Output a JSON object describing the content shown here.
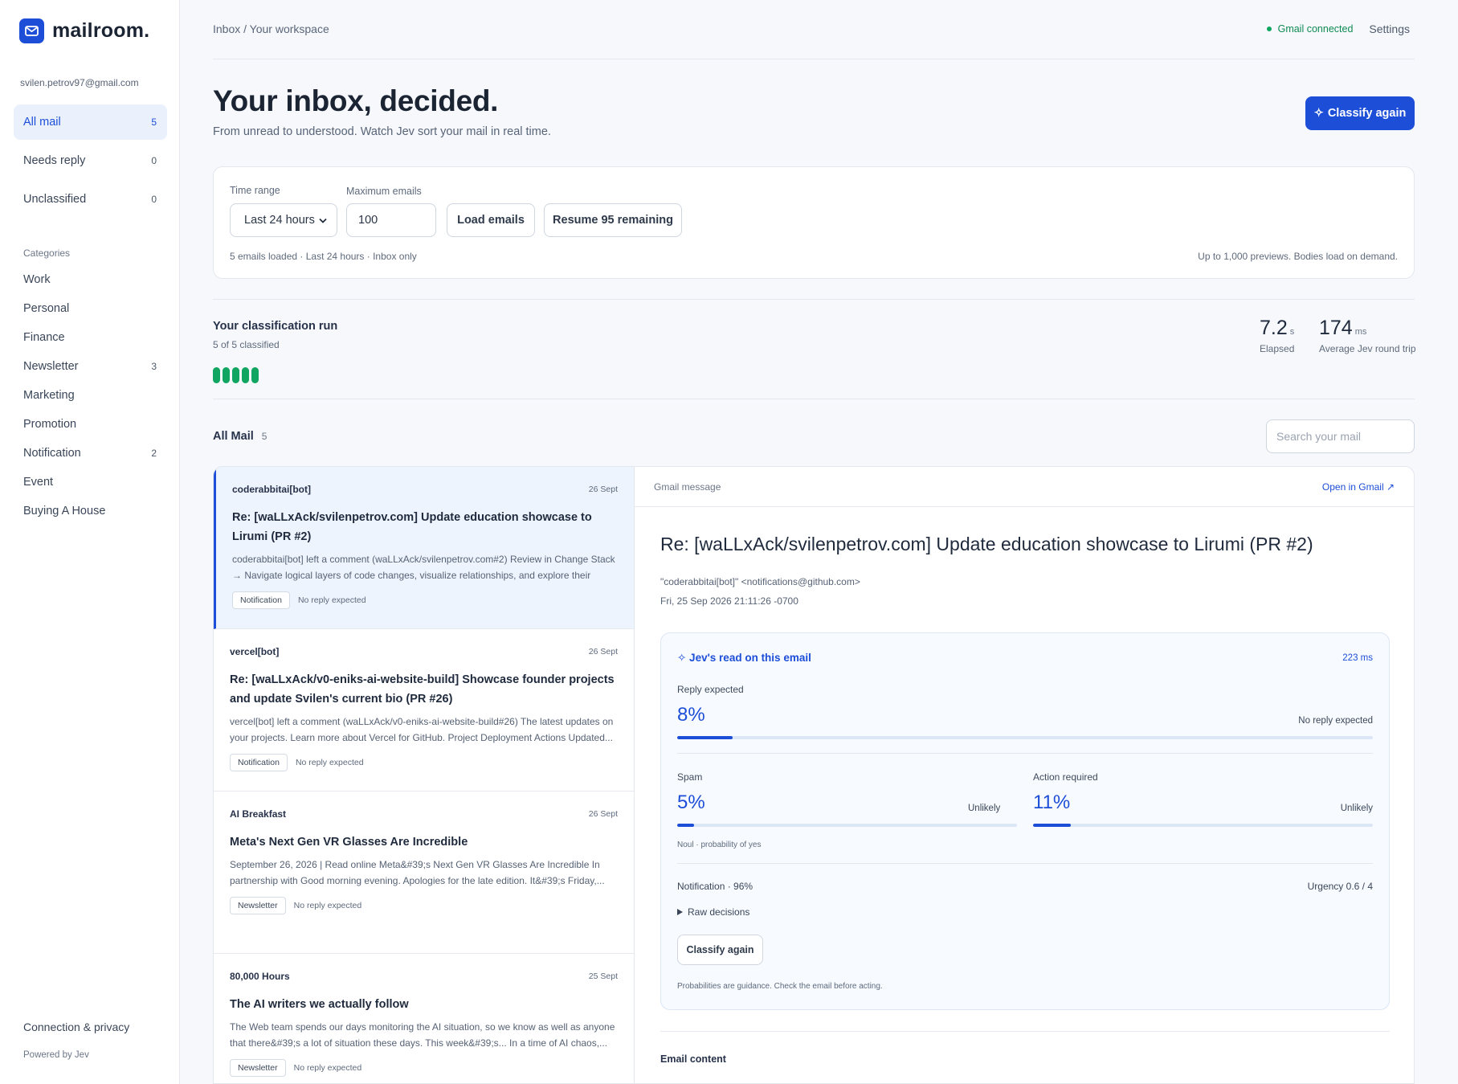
{
  "brand": {
    "name": "mailroom."
  },
  "account": {
    "email": "svilen.petrov97@gmail.com"
  },
  "nav": [
    {
      "label": "All mail",
      "count": "5"
    },
    {
      "label": "Needs reply",
      "count": "0"
    },
    {
      "label": "Unclassified",
      "count": "0"
    }
  ],
  "categories_header": "Categories",
  "categories": [
    {
      "label": "Work",
      "count": ""
    },
    {
      "label": "Personal",
      "count": ""
    },
    {
      "label": "Finance",
      "count": ""
    },
    {
      "label": "Newsletter",
      "count": "3"
    },
    {
      "label": "Marketing",
      "count": ""
    },
    {
      "label": "Promotion",
      "count": ""
    },
    {
      "label": "Notification",
      "count": "2"
    },
    {
      "label": "Event",
      "count": ""
    },
    {
      "label": "Buying A House",
      "count": ""
    }
  ],
  "sidebar_footer": {
    "link": "Connection & privacy",
    "powered": "Powered by Jev"
  },
  "topbar": {
    "breadcrumb": "Inbox / Your workspace",
    "status": "Gmail connected",
    "settings": "Settings"
  },
  "hero": {
    "title": "Your inbox, decided.",
    "subtitle": "From unread to understood. Watch Jev sort your mail in real time.",
    "classify_label": "Classify again"
  },
  "loader": {
    "time_label": "Time range",
    "time_value": "Last 24 hours",
    "max_label": "Maximum emails",
    "max_value": "100",
    "load_button": "Load emails",
    "resume_button": "Resume 95 remaining",
    "status": "5 emails loaded · Last 24 hours · Inbox only",
    "note": "Up to 1,000 previews. Bodies load on demand."
  },
  "run": {
    "title": "Your classification run",
    "subtitle": "5 of 5 classified",
    "classified": 5,
    "elapsed_value": "7.2",
    "elapsed_unit": "s",
    "elapsed_label": "Elapsed",
    "rtt_value": "174",
    "rtt_unit": "ms",
    "rtt_label": "Average Jev round trip"
  },
  "list_header": {
    "title": "All Mail",
    "count": "5",
    "search_placeholder": "Search your mail"
  },
  "emails": [
    {
      "from": "coderabbitai[bot]",
      "date": "26 Sept",
      "subject": "Re: [waLLxAck/svilenpetrov.com] Update education showcase to Lirumi (PR #2)",
      "snippet": "coderabbitai[bot] left a comment (waLLxAck/svilenpetrov.com#2) Review in Change Stack → Navigate logical layers of code changes, visualize relationships, and explore their blast...",
      "tag": "Notification",
      "reply": "No reply expected"
    },
    {
      "from": "vercel[bot]",
      "date": "26 Sept",
      "subject": "Re: [waLLxAck/v0-eniks-ai-website-build] Showcase founder projects and update Svilen's current bio (PR #26)",
      "snippet": "vercel[bot] left a comment (waLLxAck/v0-eniks-ai-website-build#26) The latest updates on your projects. Learn more about Vercel for GitHub. Project Deployment Actions Updated...",
      "tag": "Notification",
      "reply": "No reply expected"
    },
    {
      "from": "AI Breakfast",
      "date": "26 Sept",
      "subject": "Meta's Next Gen VR Glasses Are Incredible",
      "snippet": "September 26, 2026 | Read online Meta&#39;s Next Gen VR Glasses Are Incredible In partnership with Good morning evening. Apologies for the late edition. It&#39;s Friday,...",
      "tag": "Newsletter",
      "reply": "No reply expected"
    },
    {
      "from": "80,000 Hours",
      "date": "25 Sept",
      "subject": "The AI writers we actually follow",
      "snippet": "The Web team spends our days monitoring the AI situation, so we know as well as anyone that there&#39;s a lot of situation these days. This week&#39;s... In a time of AI chaos,...",
      "tag": "Newsletter",
      "reply": "No reply expected"
    }
  ],
  "detail": {
    "header_label": "Gmail message",
    "open_link": "Open in Gmail ↗",
    "subject": "Re: [waLLxAck/svilenpetrov.com] Update education showcase to Lirumi (PR #2)",
    "from": "\"coderabbitai[bot]\" <notifications@github.com>",
    "date": "Fri, 25 Sep 2026 21:11:26 -0700",
    "read": {
      "title": "✧ Jev's read on this email",
      "latency": "223 ms",
      "reply_label": "Reply expected",
      "reply_value": "8%",
      "reply_fraction": 0.08,
      "reply_verdict": "No reply expected",
      "spam_label": "Spam",
      "spam_value": "5%",
      "spam_fraction": 0.05,
      "spam_verdict": "Unlikely",
      "action_label": "Action required",
      "action_value": "11%",
      "action_fraction": 0.11,
      "action_verdict": "Unlikely",
      "footnote": "Noul · probability of yes",
      "notification": "Notification · 96%",
      "urgency": "Urgency 0.6 / 4",
      "raw": "Raw decisions",
      "classify_button": "Classify again",
      "guidance": "Probabilities are guidance. Check the email before acting."
    },
    "content_label": "Email content"
  },
  "colors": {
    "accent": "#1d4ed8",
    "success": "#10a560",
    "sidebar_active_bg": "#eaf1fd"
  }
}
